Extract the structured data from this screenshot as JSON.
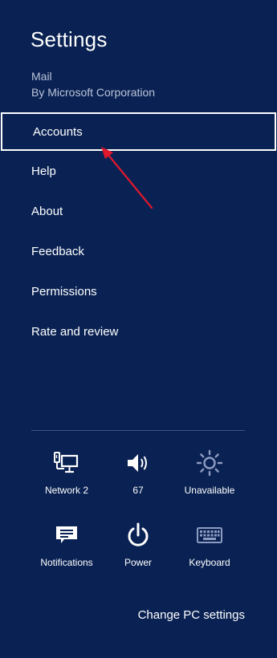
{
  "panel": {
    "title": "Settings",
    "app_name": "Mail",
    "app_publisher": "By Microsoft Corporation"
  },
  "menu": {
    "items": [
      {
        "label": "Accounts",
        "selected": true
      },
      {
        "label": "Help"
      },
      {
        "label": "About"
      },
      {
        "label": "Feedback"
      },
      {
        "label": "Permissions"
      },
      {
        "label": "Rate and review"
      }
    ]
  },
  "quick_settings": {
    "network": {
      "label": "Network  2",
      "icon": "network-icon"
    },
    "volume": {
      "label": "67",
      "icon": "speaker-icon"
    },
    "brightness": {
      "label": "Unavailable",
      "icon": "brightness-icon"
    },
    "notifications": {
      "label": "Notifications",
      "icon": "notifications-icon"
    },
    "power": {
      "label": "Power",
      "icon": "power-icon"
    },
    "keyboard": {
      "label": "Keyboard",
      "icon": "keyboard-icon"
    }
  },
  "footer": {
    "change_pc_settings": "Change PC settings"
  },
  "colors": {
    "background": "#0a2253",
    "annotation_arrow": "#e0182d"
  }
}
